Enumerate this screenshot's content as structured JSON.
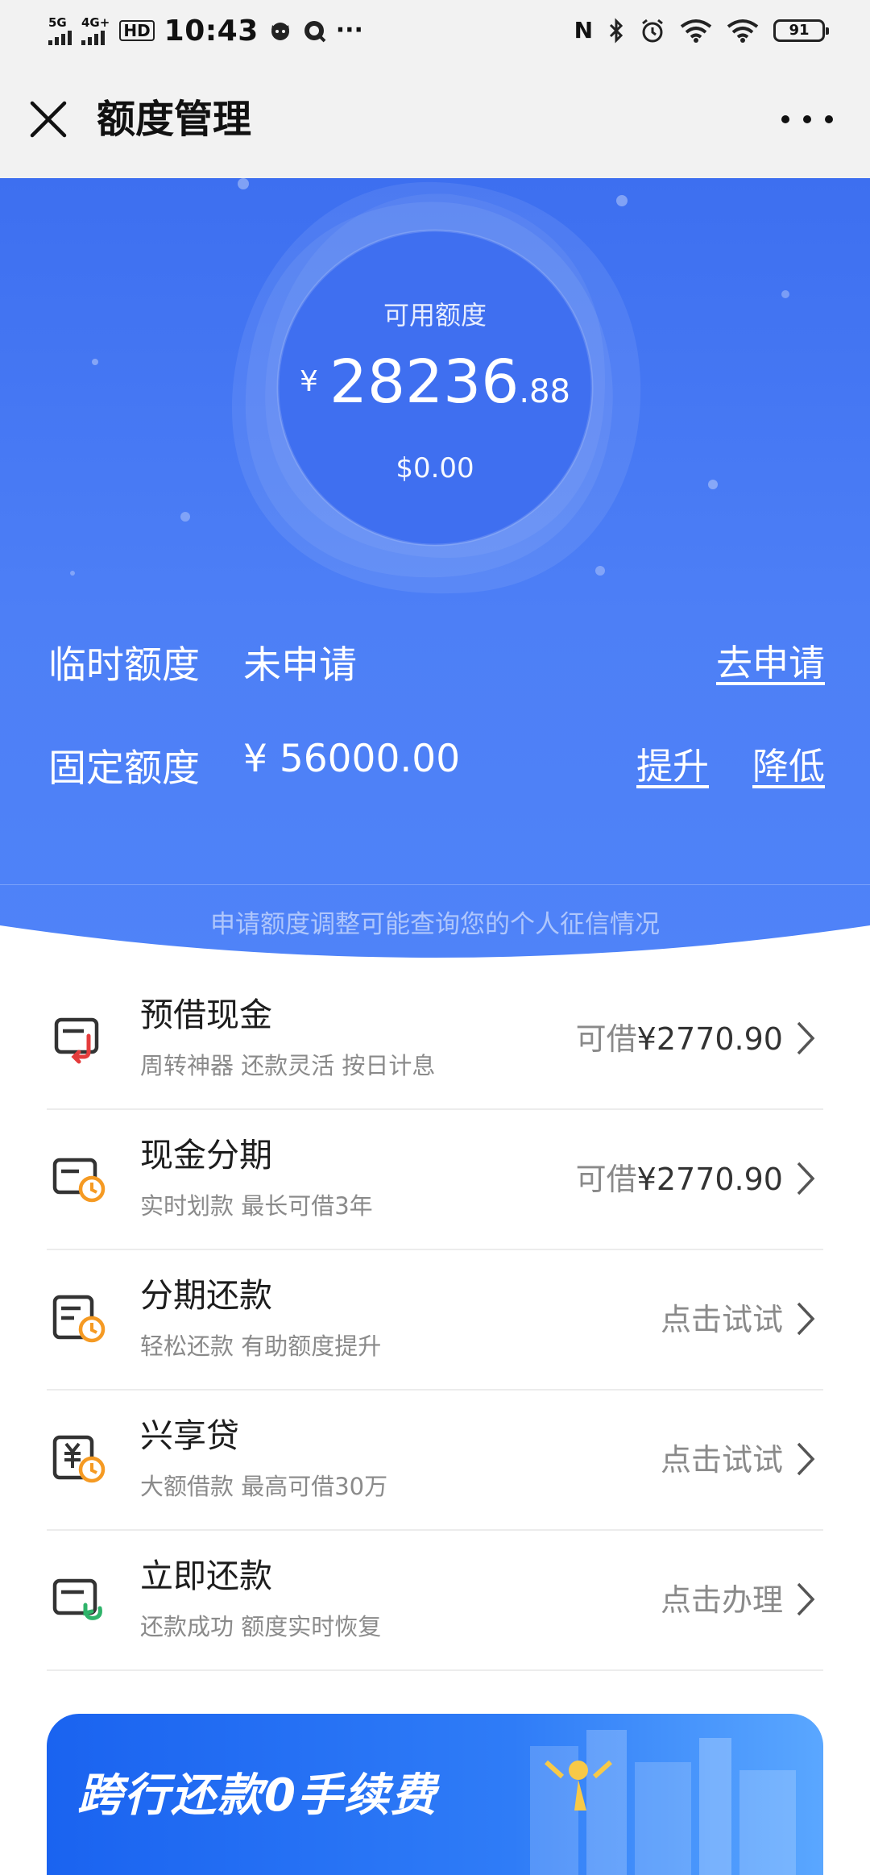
{
  "status_bar": {
    "network1": "5G",
    "network2": "4G+",
    "hd": "HD",
    "time": "10:43",
    "battery": "91"
  },
  "header": {
    "title": "额度管理"
  },
  "credit": {
    "available_label": "可用额度",
    "currency_symbol": "¥",
    "available_int": "28236",
    "available_dec": ".88",
    "usd_amount": "$0.00",
    "temp_label": "临时额度",
    "temp_value": "未申请",
    "temp_link": "去申请",
    "fixed_label": "固定额度",
    "fixed_value": "¥ 56000.00",
    "raise_link": "提升",
    "lower_link": "降低",
    "notice": "申请额度调整可能查询您的个人征信情况"
  },
  "colors": {
    "primary_blue": "#4a7cf5",
    "icon_red": "#e43c3c",
    "icon_orange": "#f59a23",
    "icon_green": "#2fb36a"
  },
  "services": [
    {
      "title": "预借现金",
      "subtitle": "周转神器 还款灵活 按日计息",
      "right_prefix": "可借",
      "right_amount": "¥2770.90",
      "icon": "cash-advance-icon"
    },
    {
      "title": "现金分期",
      "subtitle": "实时划款 最长可借3年",
      "right_prefix": "可借",
      "right_amount": "¥2770.90",
      "icon": "cash-installment-icon"
    },
    {
      "title": "分期还款",
      "subtitle": "轻松还款 有助额度提升",
      "right_prefix": "点击试试",
      "right_amount": "",
      "icon": "installment-repay-icon"
    },
    {
      "title": "兴享贷",
      "subtitle": "大额借款 最高可借30万",
      "right_prefix": "点击试试",
      "right_amount": "",
      "icon": "loan-icon"
    },
    {
      "title": "立即还款",
      "subtitle": "还款成功 额度实时恢复",
      "right_prefix": "点击办理",
      "right_amount": "",
      "icon": "repay-now-icon"
    }
  ],
  "banner": {
    "text": "跨行还款0手续费"
  }
}
